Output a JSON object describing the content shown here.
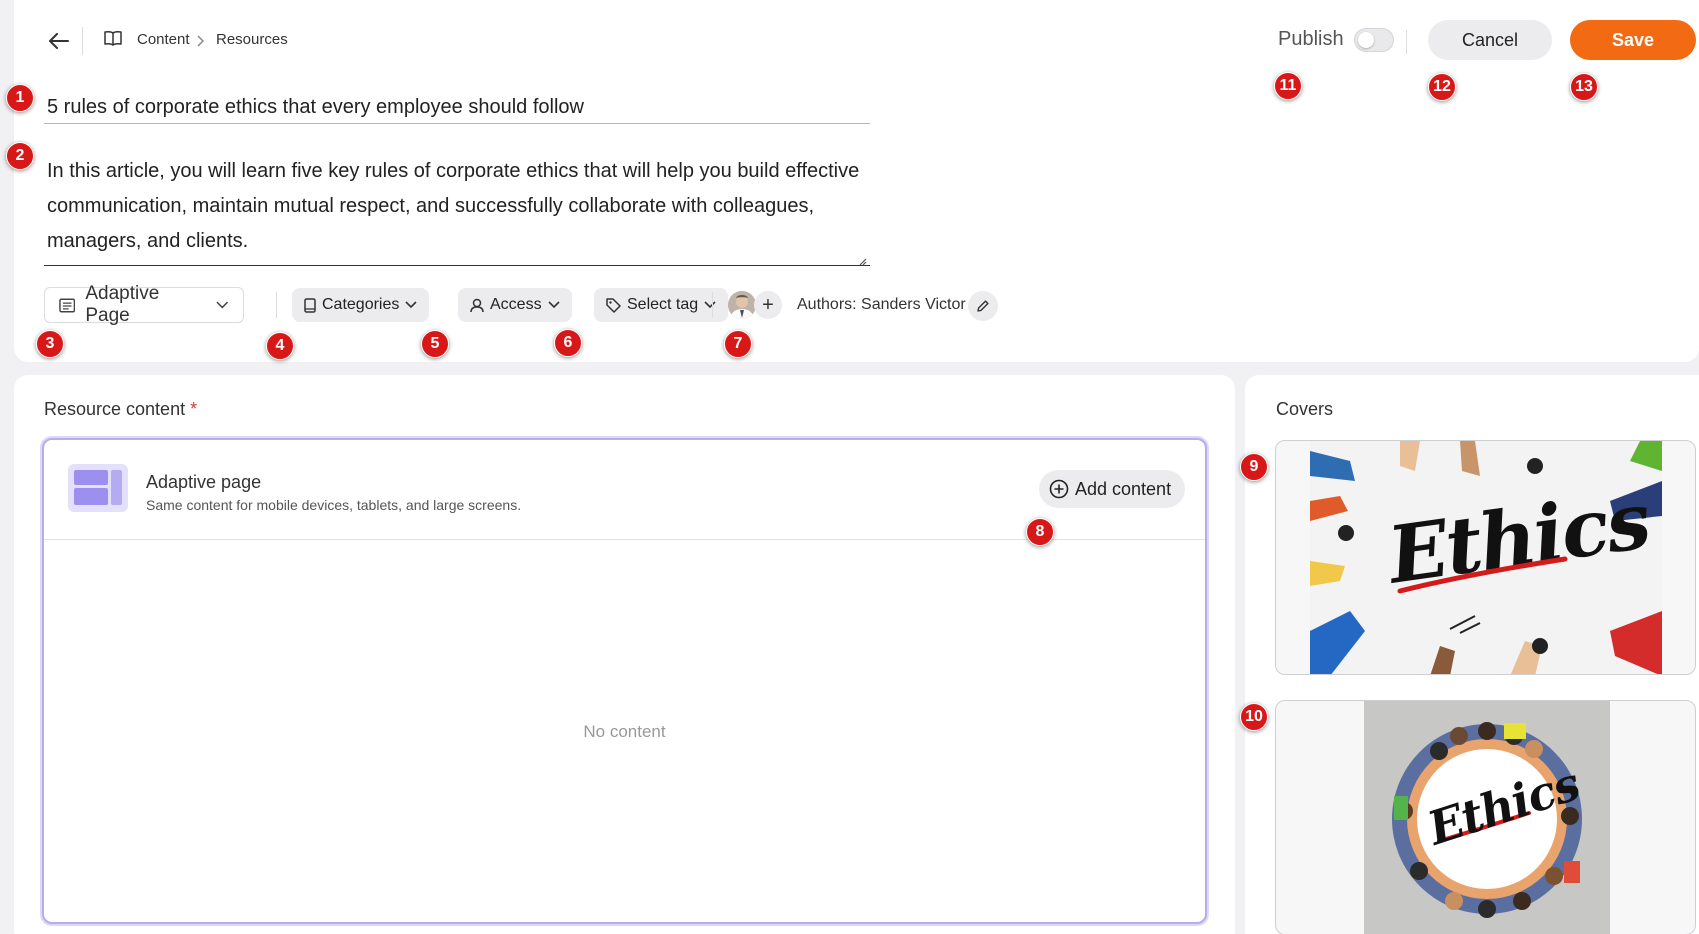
{
  "breadcrumb": {
    "content": "Content",
    "resources": "Resources"
  },
  "actions": {
    "publish_label": "Publish",
    "cancel_label": "Cancel",
    "save_label": "Save"
  },
  "resource": {
    "title": "5 rules of corporate ethics that every employee should follow",
    "description": "In this article, you will learn five key rules of corporate ethics that will help you build effective communication, maintain mutual respect, and successfully collaborate with colleagues, managers, and clients."
  },
  "toolbar": {
    "page_type": "Adaptive Page",
    "categories": "Categories",
    "access": "Access",
    "tag": "Select tag",
    "authors": "Authors: Sanders Victor"
  },
  "content_section": {
    "title": "Resource content",
    "required_mark": "*",
    "adaptive_title": "Adaptive page",
    "adaptive_subtitle": "Same content for mobile devices, tablets, and large screens.",
    "add_content": "Add content",
    "empty_text": "No content"
  },
  "covers_section": {
    "title": "Covers",
    "cover_text_1": "Ethics",
    "cover_text_2": "Ethics"
  },
  "markers": [
    "1",
    "2",
    "3",
    "4",
    "5",
    "6",
    "7",
    "8",
    "9",
    "10",
    "11",
    "12",
    "13"
  ],
  "colors": {
    "accent": "#f26a12",
    "marker": "#d81818",
    "focus_border": "#b6adeb"
  }
}
